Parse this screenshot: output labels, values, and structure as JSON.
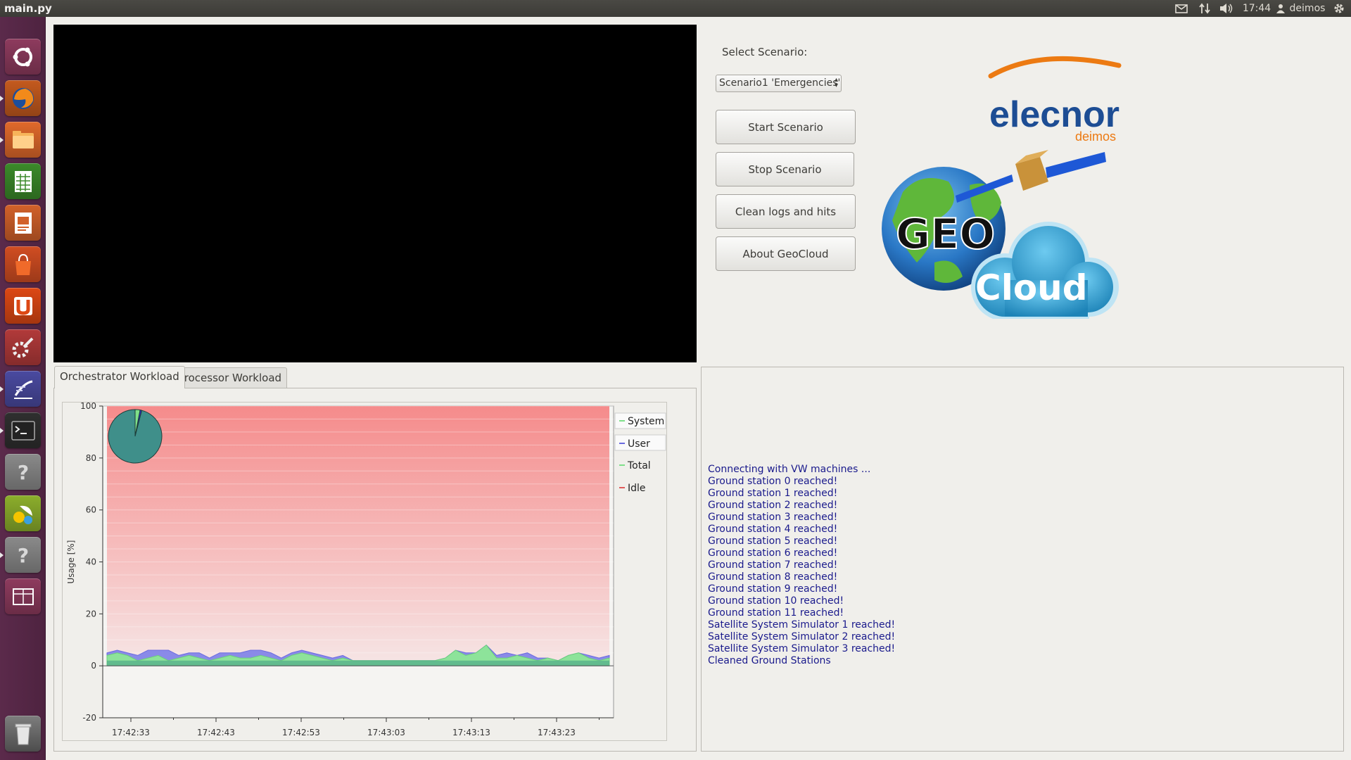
{
  "window": {
    "title": "main.py"
  },
  "topbar": {
    "clock": "17:44",
    "user": "deimos"
  },
  "launcher": {
    "items": [
      {
        "name": "ubuntu-dash-icon",
        "color": "#8e3b5e"
      },
      {
        "name": "firefox-icon",
        "color": "#c45a1e"
      },
      {
        "name": "files-icon",
        "color": "#e0692b"
      },
      {
        "name": "libreoffice-calc-icon",
        "color": "#3b8a2a"
      },
      {
        "name": "libreoffice-impress-icon",
        "color": "#d2612a"
      },
      {
        "name": "software-center-icon",
        "color": "#d14d22"
      },
      {
        "name": "ubuntu-one-icon",
        "color": "#dd4814"
      },
      {
        "name": "system-settings-icon",
        "color": "#b23a3a"
      },
      {
        "name": "editor-icon",
        "color": "#4a4aa0"
      },
      {
        "name": "terminal-icon",
        "color": "#2f2f2f"
      },
      {
        "name": "unknown-app-icon",
        "color": "#8a8a8a"
      },
      {
        "name": "app-icon",
        "color": "#8cae2c"
      },
      {
        "name": "unknown-app-icon",
        "color": "#8a8a8a"
      },
      {
        "name": "workspace-switcher-icon",
        "color": "#8e3b5e"
      }
    ],
    "trash": {
      "name": "trash-icon",
      "color": "#7d7d7d"
    }
  },
  "controls": {
    "scenario_label": "Select Scenario:",
    "scenario_selected": "Scenario1 'Emergencies'",
    "buttons": {
      "start": "Start Scenario",
      "stop": "Stop Scenario",
      "clean": "Clean logs and hits",
      "about": "About GeoCloud"
    }
  },
  "logo": {
    "company": "elecnor",
    "company_sub": "deimos",
    "geo": "GEO",
    "cloud": "Cloud"
  },
  "tabs": [
    {
      "label": "Orchestrator Workload",
      "active": true
    },
    {
      "label": "Processor Workload",
      "active": false
    }
  ],
  "chart_data": {
    "type": "area",
    "ylabel": "Usage [%]",
    "ylim": [
      -20,
      100
    ],
    "yticks": [
      100,
      80,
      60,
      40,
      20,
      0,
      -20
    ],
    "x_tick_labels": [
      "17:42:33",
      "17:42:43",
      "17:42:53",
      "17:43:03",
      "17:43:13",
      "17:43:23"
    ],
    "x_start": "17:42:33",
    "x_step_seconds": 1,
    "legend": [
      "System",
      "User",
      "Total",
      "Idle"
    ],
    "legend_position": "right",
    "colors": {
      "System": "#7fe08a",
      "User": "#6a6ae0",
      "Total": "#7fe08a",
      "Idle": "#e05a5a"
    },
    "series": [
      {
        "name": "System",
        "values": [
          4,
          5,
          4,
          2,
          3,
          4,
          2,
          3,
          4,
          3,
          2,
          3,
          4,
          3,
          3,
          4,
          3,
          2,
          4,
          5,
          4,
          3,
          2,
          3,
          2,
          2,
          2,
          2,
          2,
          2,
          2,
          2,
          2,
          3,
          6,
          4,
          5,
          8,
          3,
          3,
          4,
          3,
          2,
          3,
          2,
          4,
          5,
          3,
          2,
          3
        ]
      },
      {
        "name": "User",
        "values": [
          1,
          1,
          1,
          2,
          3,
          2,
          4,
          1,
          1,
          2,
          1,
          2,
          1,
          2,
          3,
          2,
          2,
          1,
          1,
          1,
          1,
          1,
          1,
          1,
          0,
          0,
          0,
          0,
          0,
          0,
          0,
          0,
          0,
          0,
          0,
          1,
          0,
          0,
          1,
          2,
          0,
          2,
          1,
          0,
          0,
          0,
          0,
          1,
          1,
          1
        ]
      },
      {
        "name": "Idle",
        "values": [
          95,
          94,
          95,
          96,
          94,
          94,
          94,
          96,
          95,
          95,
          97,
          95,
          95,
          95,
          94,
          94,
          95,
          97,
          95,
          94,
          95,
          96,
          97,
          96,
          98,
          98,
          98,
          98,
          98,
          98,
          98,
          98,
          98,
          97,
          94,
          95,
          95,
          92,
          96,
          95,
          96,
          95,
          97,
          97,
          98,
          96,
          95,
          96,
          97,
          96
        ]
      }
    ],
    "pie": [
      {
        "name": "System",
        "value": 3
      },
      {
        "name": "User",
        "value": 1
      },
      {
        "name": "Idle",
        "value": 96
      }
    ]
  },
  "log": [
    "Connecting with VW machines ...",
    "Ground station 0 reached!",
    "Ground station 1 reached!",
    "Ground station 2 reached!",
    "Ground station 3 reached!",
    "Ground station 4 reached!",
    "Ground station 5 reached!",
    "Ground station 6 reached!",
    "Ground station 7 reached!",
    "Ground station 8 reached!",
    "Ground station 9 reached!",
    "Ground station 10 reached!",
    "Ground station 11 reached!",
    "Satellite System Simulator 1 reached!",
    "Satellite System Simulator 2 reached!",
    "Satellite System Simulator 3 reached!",
    "Cleaned Ground Stations"
  ]
}
